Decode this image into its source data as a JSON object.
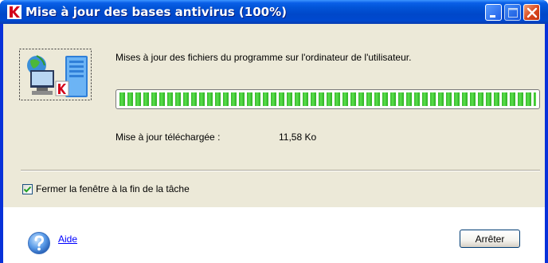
{
  "window": {
    "title": "Mise à jour des bases antivirus (100%)"
  },
  "main": {
    "description": "Mises à jour des fichiers du programme sur l'ordinateur de l'utilisateur.",
    "progress": 1.0,
    "downloaded_label": "Mise à jour téléchargée :",
    "downloaded_value": "11,58 Ko"
  },
  "options": {
    "close_on_finish_label": "Fermer la fenêtre à la fin de la tâche",
    "close_on_finish_checked": true
  },
  "footer": {
    "help_label": "Aide",
    "stop_label": "Arrêter"
  },
  "icons": {
    "app": "kaspersky-k-icon",
    "product": "update-computer-icon",
    "help": "question-mark-icon"
  },
  "colors": {
    "titlebar": "#0054e3",
    "progress_fill": "#36b82b",
    "close_button": "#d9471c",
    "link": "#0000ff"
  }
}
